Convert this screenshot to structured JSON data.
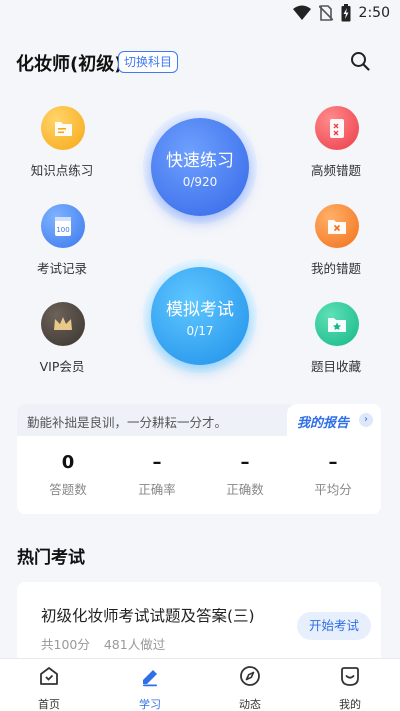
{
  "status_bar": {
    "time": "2:50"
  },
  "header": {
    "title": "化妆师(初级)",
    "switch_label": "切换科目"
  },
  "features": {
    "knowledge_practice": "知识点练习",
    "exam_records": "考试记录",
    "vip": "VIP会员",
    "frequent_errors": "高频错题",
    "my_errors": "我的错题",
    "favorites": "题目收藏"
  },
  "quick_practice": {
    "label": "快速练习",
    "progress": "0/920"
  },
  "mock_exam": {
    "label": "模拟考试",
    "progress": "0/17"
  },
  "report": {
    "motto": "勤能补拙是良训，一分耕耘一分才。",
    "link_label": "我的报告",
    "stats": [
      {
        "value": "0",
        "label": "答题数"
      },
      {
        "value": "–",
        "label": "正确率"
      },
      {
        "value": "–",
        "label": "正确数"
      },
      {
        "value": "–",
        "label": "平均分"
      }
    ]
  },
  "popular": {
    "section_title": "热门考试",
    "exam": {
      "title": "初级化妆师考试试题及答案(三)",
      "total": "共100分",
      "takers": "481人做过",
      "start_label": "开始考试"
    }
  },
  "bottom_nav": [
    {
      "label": "首页"
    },
    {
      "label": "学习"
    },
    {
      "label": "动态"
    },
    {
      "label": "我的"
    }
  ],
  "colors": {
    "accent": "#2f6fe8",
    "background": "#f5f6fa"
  }
}
